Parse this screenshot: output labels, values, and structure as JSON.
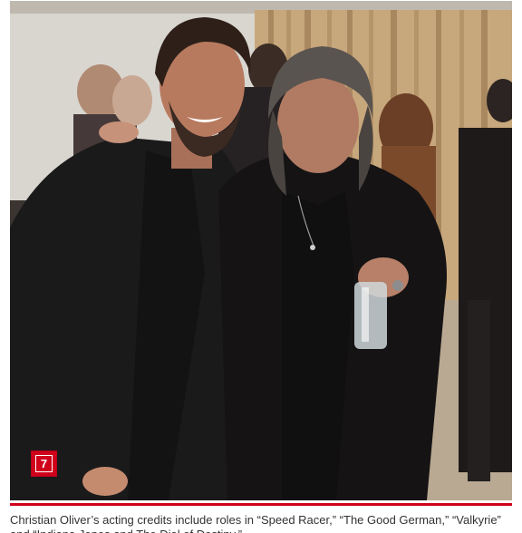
{
  "photo": {
    "gallery_index": "7",
    "accent_color": "#d0021b"
  },
  "caption": {
    "text": "Christian Oliver’s acting credits include roles in “Speed Racer,” “The Good German,” “Valkyrie” and “Indiana Jones and The Dial of Destiny.”"
  }
}
